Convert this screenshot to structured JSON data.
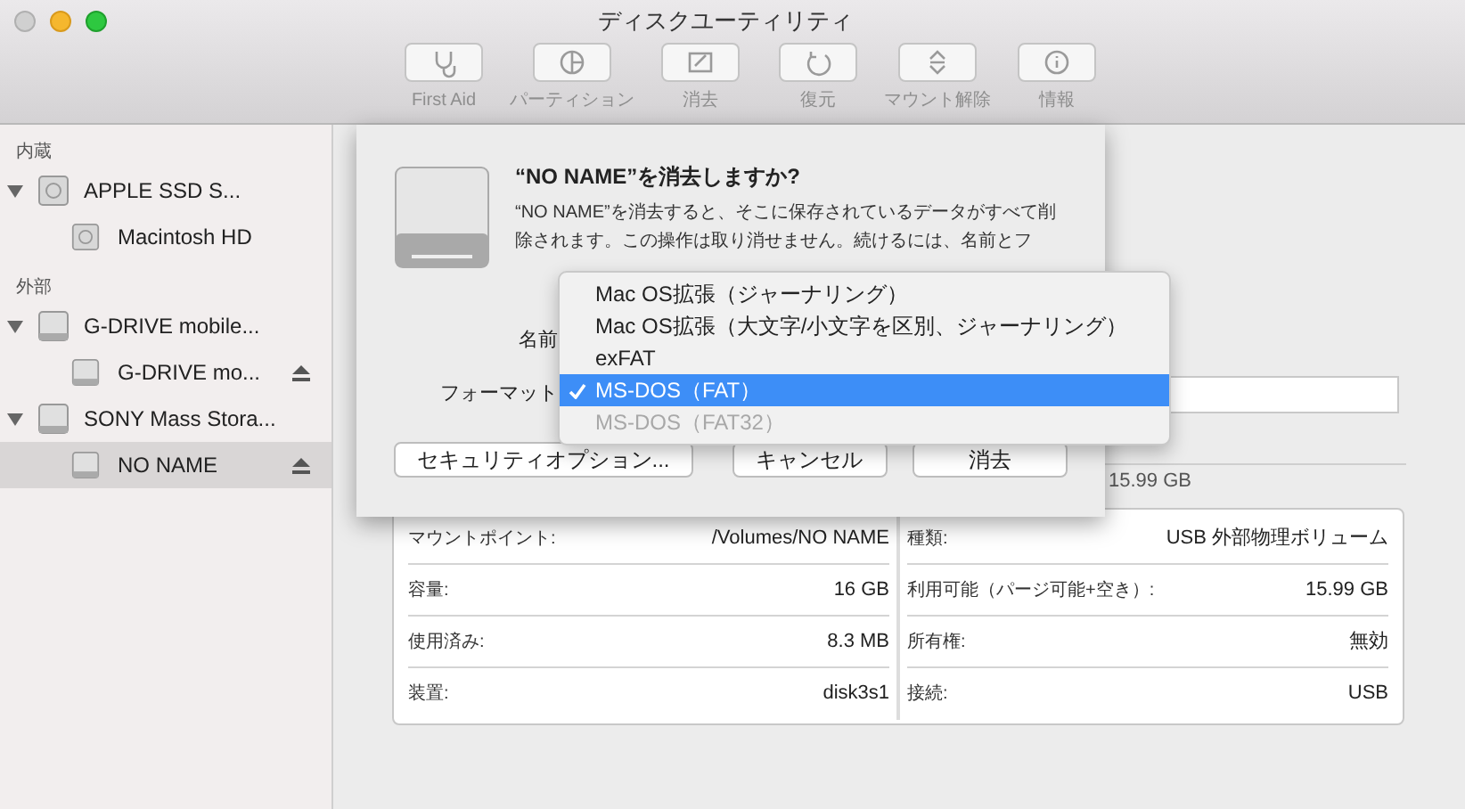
{
  "window": {
    "title": "ディスクユーティリティ"
  },
  "toolbar": [
    {
      "label": "First Aid",
      "kind": "stethoscope",
      "disabled": true
    },
    {
      "label": "パーティション",
      "kind": "pie",
      "disabled": true
    },
    {
      "label": "消去",
      "kind": "erase",
      "disabled": true
    },
    {
      "label": "復元",
      "kind": "restore",
      "disabled": true
    },
    {
      "label": "マウント解除",
      "kind": "unmount",
      "disabled": true
    },
    {
      "label": "情報",
      "kind": "info",
      "disabled": true
    }
  ],
  "sidebar": [
    {
      "title": "内蔵",
      "items": [
        {
          "name": "APPLE SSD S...",
          "kind": "internal",
          "expanded": true,
          "selected": false,
          "children": [
            {
              "name": "Macintosh HD",
              "kind": "internal",
              "selected": false,
              "eject": false
            }
          ]
        }
      ]
    },
    {
      "title": "外部",
      "items": [
        {
          "name": "G-DRIVE mobile...",
          "kind": "external",
          "expanded": true,
          "selected": false,
          "children": [
            {
              "name": "G-DRIVE mo...",
              "kind": "external",
              "selected": false,
              "eject": true
            }
          ]
        },
        {
          "name": "SONY Mass Stora...",
          "kind": "external",
          "expanded": true,
          "selected": false,
          "children": [
            {
              "name": "NO NAME",
              "kind": "external",
              "selected": true,
              "eject": true
            }
          ]
        }
      ]
    }
  ],
  "background": {
    "available_value": "15.99 GB"
  },
  "info": [
    {
      "label": "マウントポイント:",
      "value": "/Volumes/NO NAME",
      "label_2": "種類:",
      "value_2": "USB 外部物理ボリューム"
    },
    {
      "label": "容量:",
      "value": "16 GB",
      "label_2": "利用可能（パージ可能+空き）:",
      "value_2": "15.99 GB"
    },
    {
      "label": "使用済み:",
      "value": "8.3 MB",
      "label_2": "所有権:",
      "value_2": "無効"
    },
    {
      "label": "装置:",
      "value": "disk3s1",
      "label_2": "接続:",
      "value_2": "USB"
    }
  ],
  "dialog": {
    "title": "“NO NAME”を消去しますか?",
    "message": "“NO NAME”を消去すると、そこに保存されているデータがすべて削除されます。この操作は取り消せません。続けるには、名前とフ",
    "name_label": "名前",
    "format_label": "フォーマット",
    "buttons": [
      "セキュリティオプション...",
      "キャンセル",
      "消去"
    ]
  },
  "format_menu": [
    {
      "label": "Mac OS拡張（ジャーナリング）",
      "selected": false,
      "disabled": false
    },
    {
      "label": "Mac OS拡張（大文字/小文字を区別、ジャーナリング）",
      "selected": false,
      "disabled": false
    },
    {
      "label": "exFAT",
      "selected": false,
      "disabled": false
    },
    {
      "label": "MS-DOS（FAT）",
      "selected": true,
      "disabled": false
    },
    {
      "label": "MS-DOS（FAT32）",
      "selected": false,
      "disabled": true
    }
  ]
}
